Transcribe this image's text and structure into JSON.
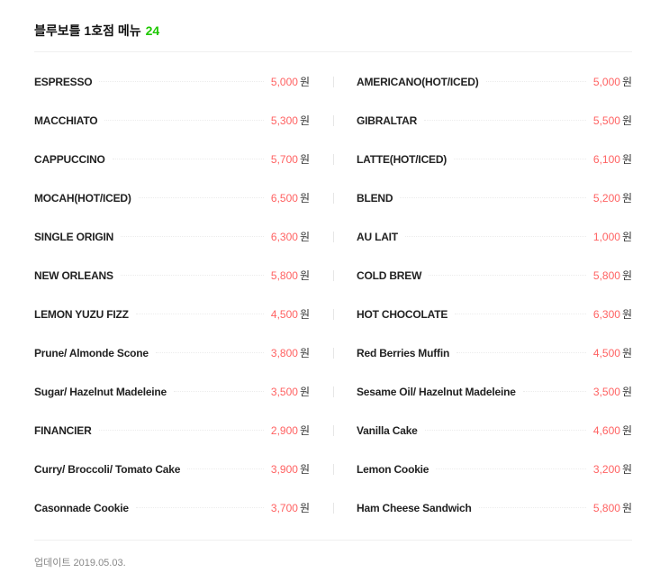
{
  "header": {
    "title": "블루보틀 1호점 메뉴",
    "count": "24"
  },
  "currency": "원",
  "colors": {
    "price": "#ff6262",
    "count": "#1ec800"
  },
  "menu_rows": [
    [
      {
        "name": "ESPRESSO",
        "price": "5,000"
      },
      {
        "name": "AMERICANO(HOT/ICED)",
        "price": "5,000"
      }
    ],
    [
      {
        "name": "MACCHIATO",
        "price": "5,300"
      },
      {
        "name": "GIBRALTAR",
        "price": "5,500"
      }
    ],
    [
      {
        "name": "CAPPUCCINO",
        "price": "5,700"
      },
      {
        "name": "LATTE(HOT/ICED)",
        "price": "6,100"
      }
    ],
    [
      {
        "name": "MOCAH(HOT/ICED)",
        "price": "6,500"
      },
      {
        "name": "BLEND",
        "price": "5,200"
      }
    ],
    [
      {
        "name": "SINGLE ORIGIN",
        "price": "6,300"
      },
      {
        "name": "AU LAIT",
        "price": "1,000"
      }
    ],
    [
      {
        "name": "NEW ORLEANS",
        "price": "5,800"
      },
      {
        "name": "COLD BREW",
        "price": "5,800"
      }
    ],
    [
      {
        "name": "LEMON YUZU FIZZ",
        "price": "4,500"
      },
      {
        "name": "HOT CHOCOLATE",
        "price": "6,300"
      }
    ],
    [
      {
        "name": "Prune/ Almonde Scone",
        "price": "3,800"
      },
      {
        "name": "Red Berries Muffin",
        "price": "4,500"
      }
    ],
    [
      {
        "name": "Sugar/ Hazelnut Madeleine",
        "price": "3,500"
      },
      {
        "name": "Sesame Oil/ Hazelnut Madeleine",
        "price": "3,500"
      }
    ],
    [
      {
        "name": "FINANCIER",
        "price": "2,900"
      },
      {
        "name": "Vanilla Cake",
        "price": "4,600"
      }
    ],
    [
      {
        "name": "Curry/ Broccoli/ Tomato Cake",
        "price": "3,900"
      },
      {
        "name": "Lemon Cookie",
        "price": "3,200"
      }
    ],
    [
      {
        "name": "Casonnade Cookie",
        "price": "3,700"
      },
      {
        "name": "Ham Cheese Sandwich",
        "price": "5,800"
      }
    ]
  ],
  "footer": {
    "updated": "업데이트 2019.05.03."
  }
}
